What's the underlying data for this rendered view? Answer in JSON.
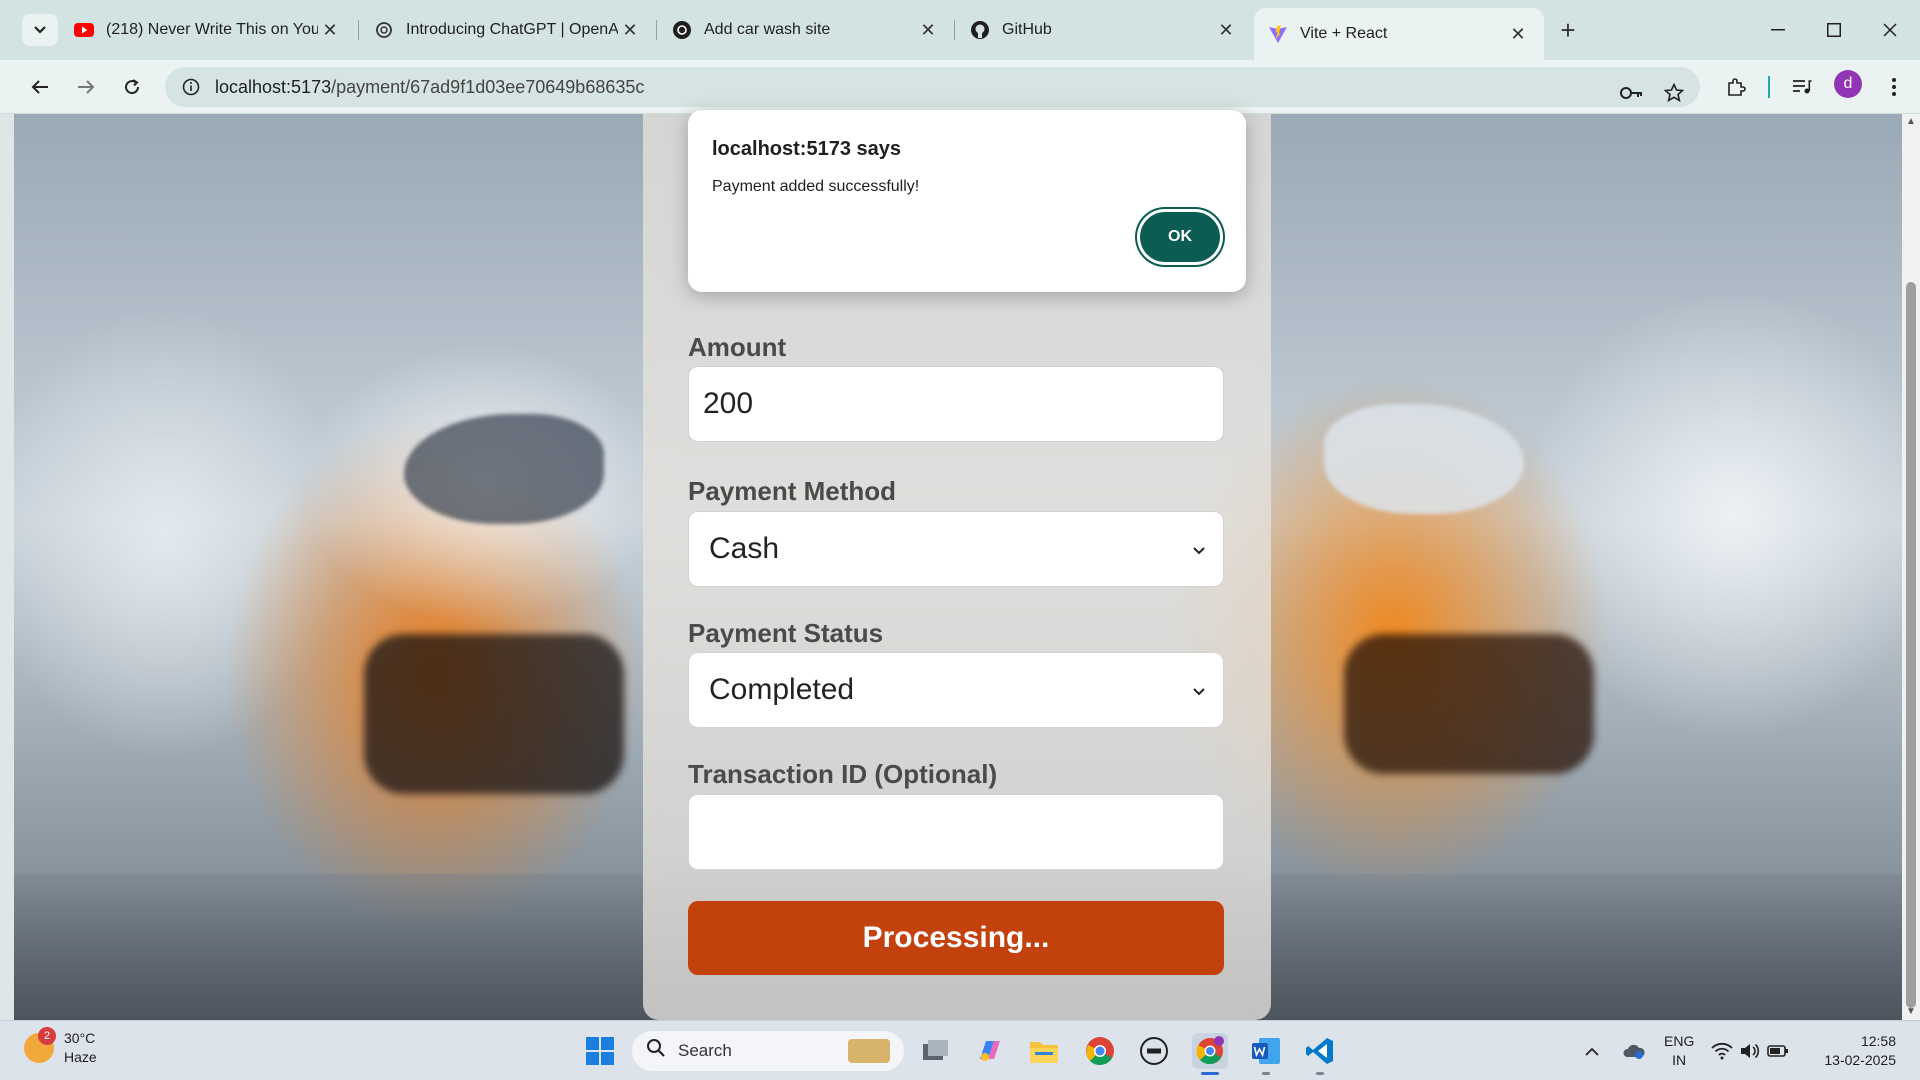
{
  "browser": {
    "tabs": [
      {
        "title": "(218) Never Write This on Your",
        "favicon": "youtube-icon",
        "active": false
      },
      {
        "title": "Introducing ChatGPT | OpenAI",
        "favicon": "openai-icon",
        "active": false
      },
      {
        "title": "Add car wash site",
        "favicon": "openai-icon",
        "active": false
      },
      {
        "title": "GitHub",
        "favicon": "github-icon",
        "active": false
      },
      {
        "title": "Vite + React",
        "favicon": "vite-icon",
        "active": true
      }
    ],
    "url_host": "localhost:5173",
    "url_path": "/payment/67ad9f1d03ee70649b68635c",
    "profile_initial": "d"
  },
  "form": {
    "amount_label": "Amount",
    "amount_value": "200",
    "method_label": "Payment Method",
    "method_value": "Cash",
    "status_label": "Payment Status",
    "status_value": "Completed",
    "txn_label": "Transaction ID (Optional)",
    "txn_value": "",
    "submit_label": "Processing..."
  },
  "dialog": {
    "title": "localhost:5173 says",
    "message": "Payment added successfully!",
    "ok_label": "OK"
  },
  "taskbar": {
    "weather_badge": "2",
    "temperature": "30°C",
    "condition": "Haze",
    "search_placeholder": "Search",
    "lang_top": "ENG",
    "lang_bottom": "IN",
    "time": "12:58",
    "date": "13-02-2025"
  },
  "colors": {
    "accent": "#c2410c",
    "dialog_button": "#0b5d53",
    "tabbar": "#d3e3e1"
  }
}
